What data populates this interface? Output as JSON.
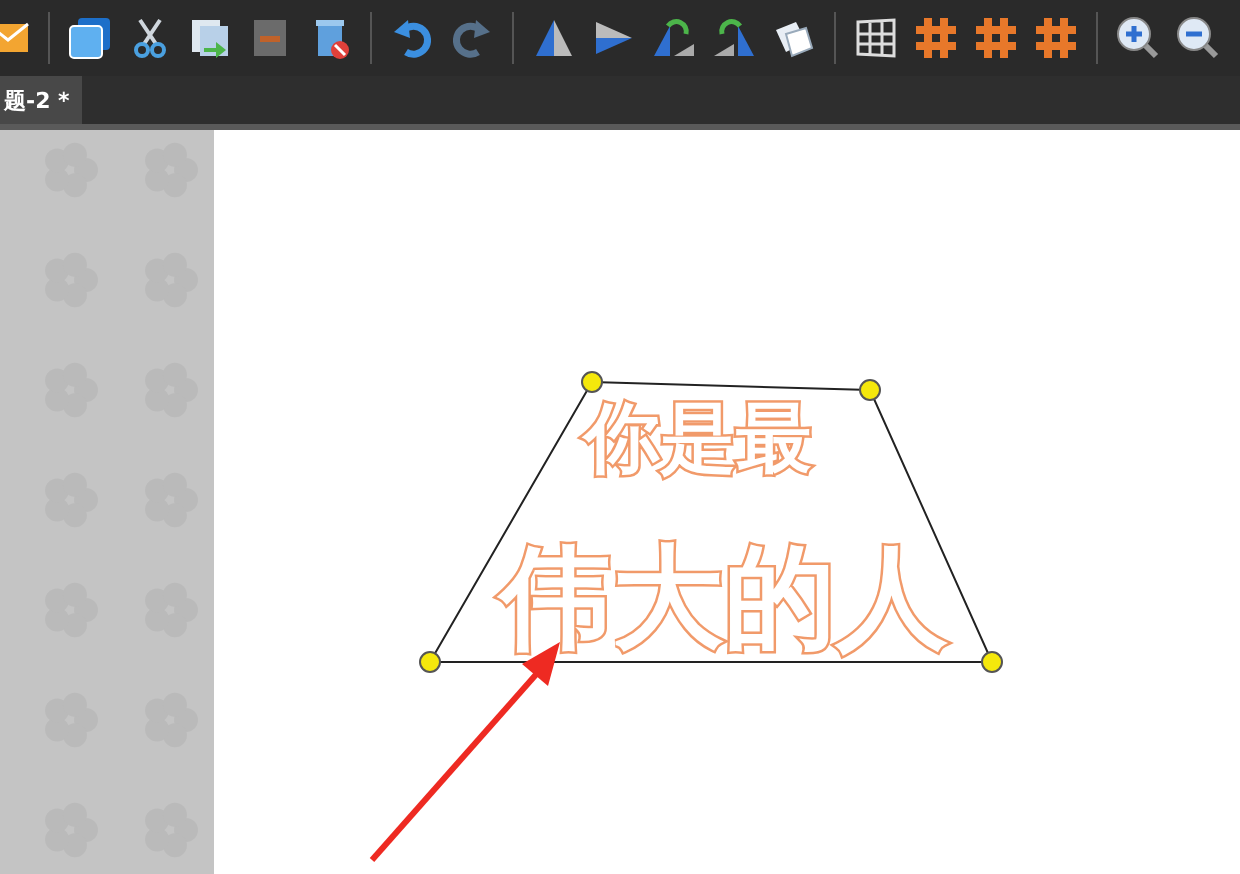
{
  "tabs": [
    {
      "label": "题-2 *",
      "selected": true
    }
  ],
  "canvas": {
    "text_lines": [
      "你是最",
      "伟大的人"
    ]
  }
}
